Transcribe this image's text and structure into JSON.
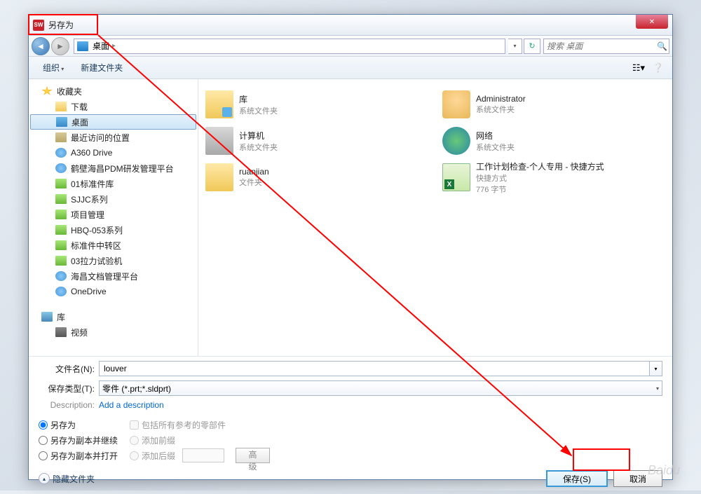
{
  "title": "另存为",
  "nav": {
    "location": "桌面"
  },
  "search": {
    "placeholder": "搜索 桌面"
  },
  "toolbar": {
    "organize": "组织",
    "newfolder": "新建文件夹"
  },
  "sidebar": {
    "favorites": "收藏夹",
    "items": [
      {
        "label": "下载",
        "icon": "i-folder"
      },
      {
        "label": "桌面",
        "icon": "i-desktop",
        "selected": true
      },
      {
        "label": "最近访问的位置",
        "icon": "i-recent"
      },
      {
        "label": "A360 Drive",
        "icon": "i-cloud"
      },
      {
        "label": "鹤壁海昌PDM研发管理平台",
        "icon": "i-cloud"
      },
      {
        "label": "01标准件库",
        "icon": "i-green"
      },
      {
        "label": "SJJC系列",
        "icon": "i-green"
      },
      {
        "label": "项目管理",
        "icon": "i-green"
      },
      {
        "label": "HBQ-053系列",
        "icon": "i-green"
      },
      {
        "label": "标准件中转区",
        "icon": "i-green"
      },
      {
        "label": "03拉力试验机",
        "icon": "i-green"
      },
      {
        "label": "海昌文档管理平台",
        "icon": "i-cloud"
      },
      {
        "label": "OneDrive",
        "icon": "i-cloud"
      }
    ],
    "libraries": "库",
    "video": "视频"
  },
  "content": [
    {
      "name": "库",
      "meta": "系统文件夹",
      "icon": "fi-lib"
    },
    {
      "name": "Administrator",
      "meta": "系统文件夹",
      "icon": "fi-user"
    },
    {
      "name": "计算机",
      "meta": "系统文件夹",
      "icon": "fi-pc"
    },
    {
      "name": "网络",
      "meta": "系统文件夹",
      "icon": "fi-net"
    },
    {
      "name": "ruanjian",
      "meta": "文件夹",
      "icon": "fi-folder"
    },
    {
      "name": "工作计划检查-个人专用 - 快捷方式",
      "meta": "快捷方式",
      "meta2": "776 字节",
      "icon": "fi-excel"
    }
  ],
  "form": {
    "filename_label": "文件名(N):",
    "filename_value": "louver",
    "filetype_label": "保存类型(T):",
    "filetype_value": "零件 (*.prt;*.sldprt)",
    "desc_label": "Description:",
    "desc_link": "Add a description"
  },
  "options": {
    "saveas": "另存为",
    "saveas_copy_continue": "另存为副本并继续",
    "saveas_copy_open": "另存为副本并打开",
    "include_refs": "包括所有参考的零部件",
    "add_prefix": "添加前缀",
    "add_suffix": "添加后缀",
    "advanced": "高级"
  },
  "footer": {
    "hide_folders": "隐藏文件夹",
    "save": "保存(S)",
    "cancel": "取消"
  },
  "watermark": "Baidu"
}
